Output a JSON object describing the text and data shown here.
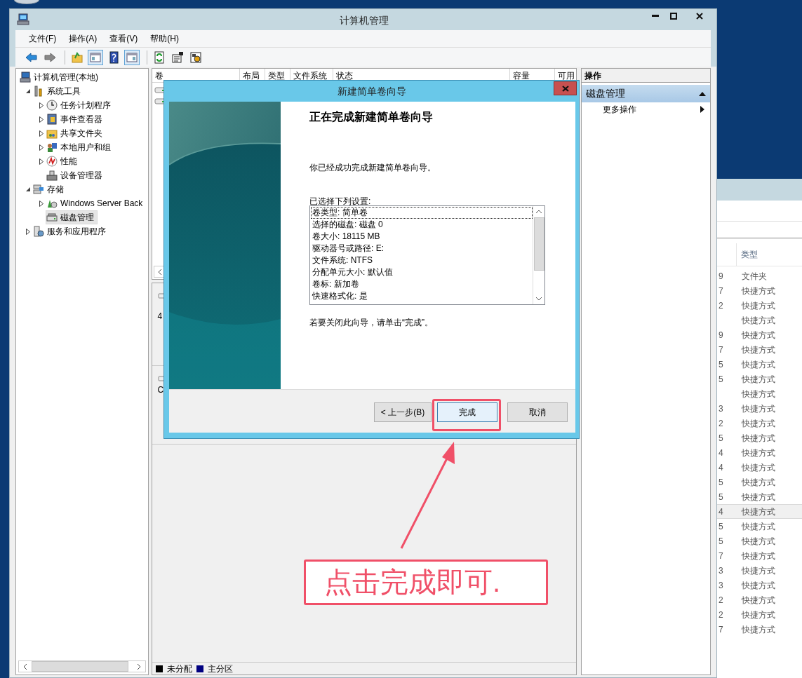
{
  "background_window": {
    "header": "类型",
    "rows": [
      {
        "column_1": "9",
        "type": "文件夹",
        "selected": false
      },
      {
        "column_1": "7",
        "type": "快捷方式",
        "selected": false
      },
      {
        "column_1": "2",
        "type": "快捷方式",
        "selected": false
      },
      {
        "type": "快捷方式",
        "selected": false
      },
      {
        "column_1": "9",
        "type": "快捷方式",
        "selected": false
      },
      {
        "column_1": "7",
        "type": "快捷方式",
        "selected": false
      },
      {
        "column_1": "5",
        "type": "快捷方式",
        "selected": false
      },
      {
        "column_1": "5",
        "type": "快捷方式",
        "selected": false
      },
      {
        "type": "快捷方式",
        "selected": false
      },
      {
        "column_1": "3",
        "type": "快捷方式",
        "selected": false
      },
      {
        "column_1": "2",
        "type": "快捷方式",
        "selected": false
      },
      {
        "column_1": "5",
        "type": "快捷方式",
        "selected": false
      },
      {
        "column_1": "4",
        "type": "快捷方式",
        "selected": false
      },
      {
        "column_1": "4",
        "type": "快捷方式",
        "selected": false
      },
      {
        "column_1": "5",
        "type": "快捷方式",
        "selected": false
      },
      {
        "column_1": "5",
        "type": "快捷方式",
        "selected": false
      },
      {
        "column_1": "4",
        "type": "快捷方式",
        "selected": true
      },
      {
        "column_1": "5",
        "type": "快捷方式",
        "selected": false
      },
      {
        "column_1": "5",
        "type": "快捷方式",
        "selected": false
      },
      {
        "column_1": "7",
        "type": "快捷方式",
        "selected": false
      },
      {
        "column_1": "3",
        "type": "快捷方式",
        "selected": false
      },
      {
        "column_1": "3",
        "type": "快捷方式",
        "selected": false
      },
      {
        "column_1": "2",
        "type": "快捷方式",
        "selected": false
      },
      {
        "column_1": "2",
        "type": "快捷方式",
        "selected": false
      },
      {
        "column_1": "7",
        "type": "快捷方式",
        "selected": false
      }
    ]
  },
  "window": {
    "title": "计算机管理"
  },
  "menu": [
    "文件(F)",
    "操作(A)",
    "查看(V)",
    "帮助(H)"
  ],
  "toolbar": [
    {
      "pressed": false
    },
    {
      "pressed": false
    },
    {
      "pressed": false
    },
    {
      "pressed": true
    },
    {
      "pressed": false
    },
    {
      "pressed": true
    },
    {
      "pressed": false
    },
    {
      "pressed": false
    },
    {
      "pressed": false
    }
  ],
  "tree": {
    "label": "计算机管理(本地)",
    "selected": false,
    "children": [
      {
        "label": "系统工具",
        "selected": false,
        "expanded": true,
        "children": [
          {
            "label": "任务计划程序",
            "selected": false,
            "expanded": false
          },
          {
            "label": "事件查看器",
            "selected": false,
            "expanded": false
          },
          {
            "label": "共享文件夹",
            "selected": false,
            "expanded": false
          },
          {
            "label": "本地用户和组",
            "selected": false,
            "expanded": false
          },
          {
            "label": "性能",
            "selected": false,
            "expanded": false
          },
          {
            "label": "设备管理器",
            "selected": false
          }
        ]
      },
      {
        "label": "存储",
        "selected": false,
        "expanded": true,
        "children": [
          {
            "label": "Windows Server Back",
            "selected": false,
            "expanded": false
          },
          {
            "label": "磁盘管理",
            "selected": true
          }
        ]
      },
      {
        "label": "服务和应用程序",
        "selected": false,
        "expanded": false
      }
    ]
  },
  "volume_table": {
    "columns": [
      "卷",
      "布局",
      "类型",
      "文件系统",
      "状态",
      "容量",
      "可用"
    ]
  },
  "disks": [
    {
      "lines": [
        "4"
      ]
    },
    {
      "lines": [
        "C"
      ]
    }
  ],
  "legend": [
    {
      "label": "未分配",
      "color": "#000000"
    },
    {
      "label": "主分区",
      "color": "#000080"
    }
  ],
  "actions": {
    "header": "操作",
    "section": "磁盘管理",
    "expanded": true,
    "items": [
      "更多操作"
    ]
  },
  "dialog": {
    "title": "新建简单卷向导",
    "heading": "正在完成新建简单卷向导",
    "intro": "你已经成功完成新建简单卷向导。",
    "list_label": "已选择下列设置:",
    "settings": [
      {
        "text": "卷类型: 简单卷",
        "selected": true
      },
      {
        "text": "选择的磁盘: 磁盘 0",
        "selected": false
      },
      {
        "text": "卷大小: 18115 MB",
        "selected": false
      },
      {
        "text": "驱动器号或路径: E:",
        "selected": false
      },
      {
        "text": "文件系统: NTFS",
        "selected": false
      },
      {
        "text": "分配单元大小: 默认值",
        "selected": false
      },
      {
        "text": "卷标: 新加卷",
        "selected": false
      },
      {
        "text": "快速格式化: 是",
        "selected": false
      }
    ],
    "closing": "若要关闭此向导，请单击“完成”。",
    "buttons": [
      {
        "label": "< 上一步(B)",
        "focused": false
      },
      {
        "label": "完成",
        "focused": true
      },
      {
        "label": "取消",
        "focused": false
      }
    ]
  },
  "annotation": {
    "text": "点击完成即可."
  }
}
